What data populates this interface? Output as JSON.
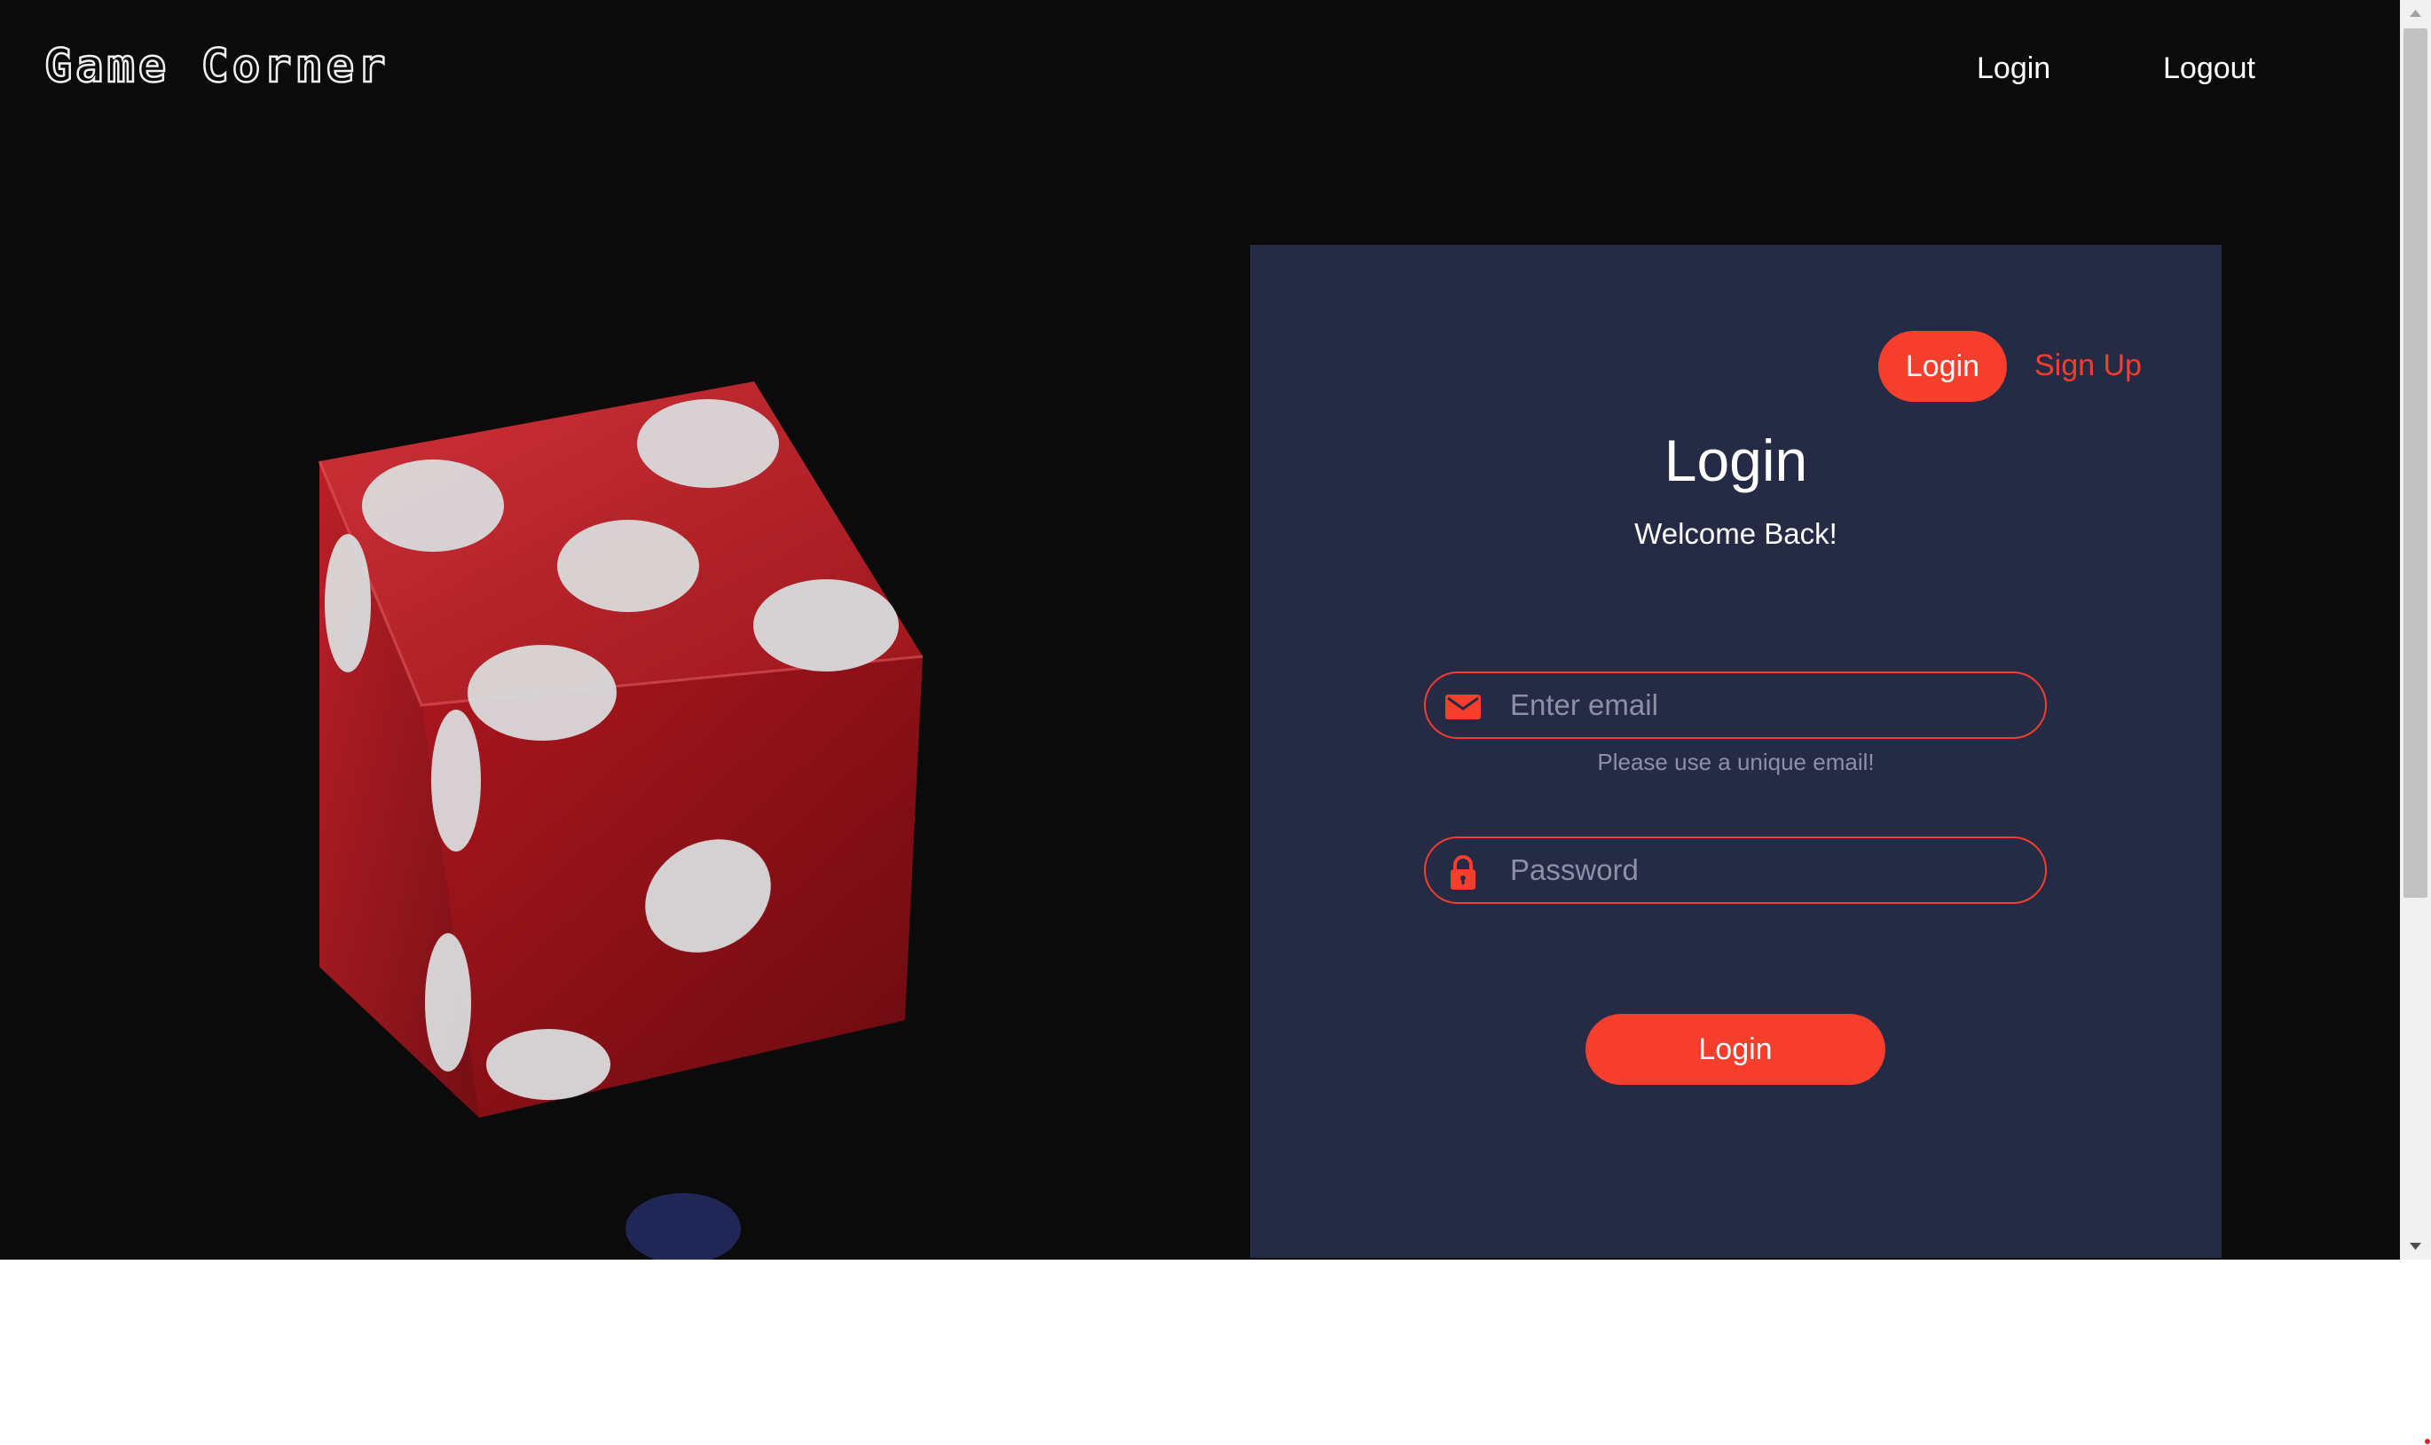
{
  "navbar": {
    "logo": "Game Corner",
    "links": {
      "login": "Login",
      "logout": "Logout"
    }
  },
  "form": {
    "toggle": {
      "login": "Login",
      "signup": "Sign Up"
    },
    "title": "Login",
    "subtitle": "Welcome Back!",
    "email": {
      "placeholder": "Enter email",
      "value": "",
      "icon": "envelope-icon"
    },
    "email_hint": "Please use a unique email!",
    "password": {
      "placeholder": "Password",
      "value": "",
      "icon": "lock-icon"
    },
    "submit_label": "Login"
  },
  "colors": {
    "accent": "#f63e2d",
    "card_background": "#252a45",
    "page_background": "#0b0b0c",
    "dice": "#c8202a"
  }
}
